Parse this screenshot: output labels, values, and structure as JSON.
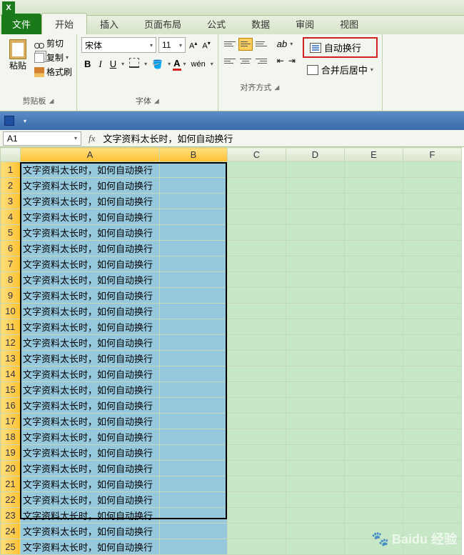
{
  "tabs": {
    "file": "文件",
    "home": "开始",
    "insert": "插入",
    "layout": "页面布局",
    "formulas": "公式",
    "data": "数据",
    "review": "审阅",
    "view": "视图"
  },
  "clipboard": {
    "paste": "粘贴",
    "cut": "剪切",
    "copy": "复制",
    "format_painter": "格式刷",
    "group": "剪贴板"
  },
  "font": {
    "name": "宋体",
    "size": "11",
    "group": "字体",
    "bold": "B",
    "italic": "I",
    "underline": "U",
    "wen": "wén",
    "color": "A",
    "Aplus": "A",
    "Aminus": "A"
  },
  "align": {
    "wrap": "自动换行",
    "merge": "合并后居中",
    "group": "对齐方式",
    "orient": "ab"
  },
  "namebox": "A1",
  "formula": "文字资料太长时，如何自动换行",
  "columns": [
    "A",
    "B",
    "C",
    "D",
    "E",
    "F"
  ],
  "cell_text": "文字资料太长时，如何自动换行",
  "rows": [
    1,
    2,
    3,
    4,
    5,
    6,
    7,
    8,
    9,
    10,
    11,
    12,
    13,
    14,
    15,
    16,
    17,
    18,
    19,
    20,
    21,
    22,
    23,
    24,
    25
  ],
  "watermark": "Baidu 经验"
}
